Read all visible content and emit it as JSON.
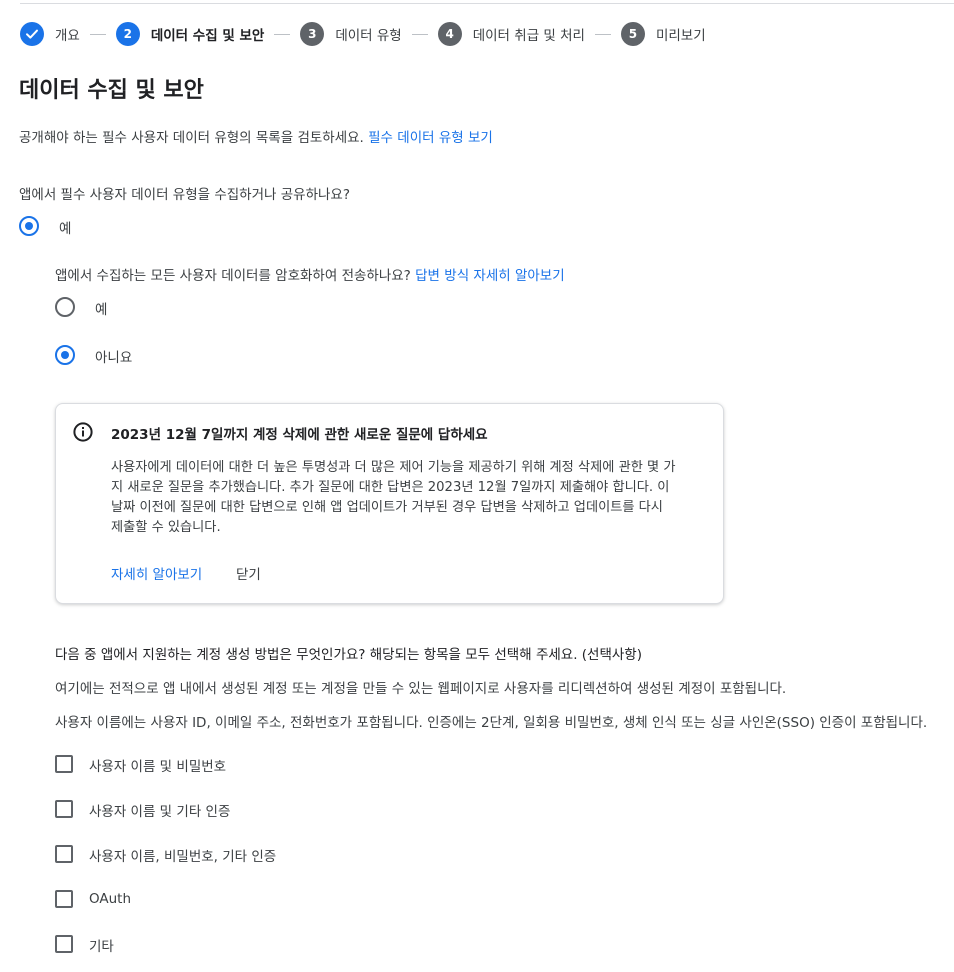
{
  "stepper": {
    "steps": [
      {
        "number": "",
        "label": "개요",
        "state": "done"
      },
      {
        "number": "2",
        "label": "데이터 수집 및 보안",
        "state": "active"
      },
      {
        "number": "3",
        "label": "데이터 유형",
        "state": "todo"
      },
      {
        "number": "4",
        "label": "데이터 취급 및 처리",
        "state": "todo"
      },
      {
        "number": "5",
        "label": "미리보기",
        "state": "todo"
      }
    ]
  },
  "page": {
    "title": "데이터 수집 및 보안",
    "intro": "공개해야 하는 필수 사용자 데이터 유형의 목록을 검토하세요.",
    "intro_link": "필수 데이터 유형 보기"
  },
  "q1": {
    "question": "앱에서 필수 사용자 데이터 유형을 수집하거나 공유하나요?",
    "yes_label": "예",
    "selected": "yes"
  },
  "q2": {
    "question": "앱에서 수집하는 모든 사용자 데이터를 암호화하여 전송하나요?",
    "link": "답변 방식 자세히 알아보기",
    "yes_label": "예",
    "no_label": "아니요",
    "selected": "no"
  },
  "notice": {
    "icon": "info-icon",
    "title": "2023년 12월 7일까지 계정 삭제에 관한 새로운 질문에 답하세요",
    "line1": "사용자에게 데이터에 대한 더 높은 투명성과 더 많은 제어 기능을 제공하기 위해 계정 삭제에 관한 몇 가",
    "line2": "지 새로운 질문을 추가했습니다. 추가 질문에 대한 답변은 2023년 12월 7일까지 제출해야 합니다. 이",
    "line3": "날짜 이전에 질문에 대한 답변으로 인해 앱 업데이트가 거부된 경우 답변을 삭제하고 업데이트를 다시",
    "line4": "제출할 수 있습니다.",
    "learn_more": "자세히 알아보기",
    "dismiss": "닫기"
  },
  "q3": {
    "question": "다음 중 앱에서 지원하는 계정 생성 방법은 무엇인가요? 해당되는 항목을 모두 선택해 주세요. (선택사항)",
    "desc1": "여기에는 전적으로 앱 내에서 생성된 계정 또는 계정을 만들 수 있는 웹페이지로 사용자를 리디렉션하여 생성된 계정이 포함됩니다.",
    "desc2": "사용자 이름에는 사용자 ID, 이메일 주소, 전화번호가 포함됩니다. 인증에는 2단계, 일회용 비밀번호, 생체 인식 또는 싱글 사인온(SSO) 인증이 포함됩니다.",
    "options": [
      {
        "label": "사용자 이름 및 비밀번호",
        "checked": false
      },
      {
        "label": "사용자 이름 및 기타 인증",
        "checked": false
      },
      {
        "label": "사용자 이름, 비밀번호, 기타 인증",
        "checked": false
      },
      {
        "label": "OAuth",
        "checked": false
      },
      {
        "label": "기타",
        "checked": false
      }
    ]
  },
  "colors": {
    "accent": "#1a73e8",
    "text": "#202124",
    "secondary": "#3c4043"
  }
}
